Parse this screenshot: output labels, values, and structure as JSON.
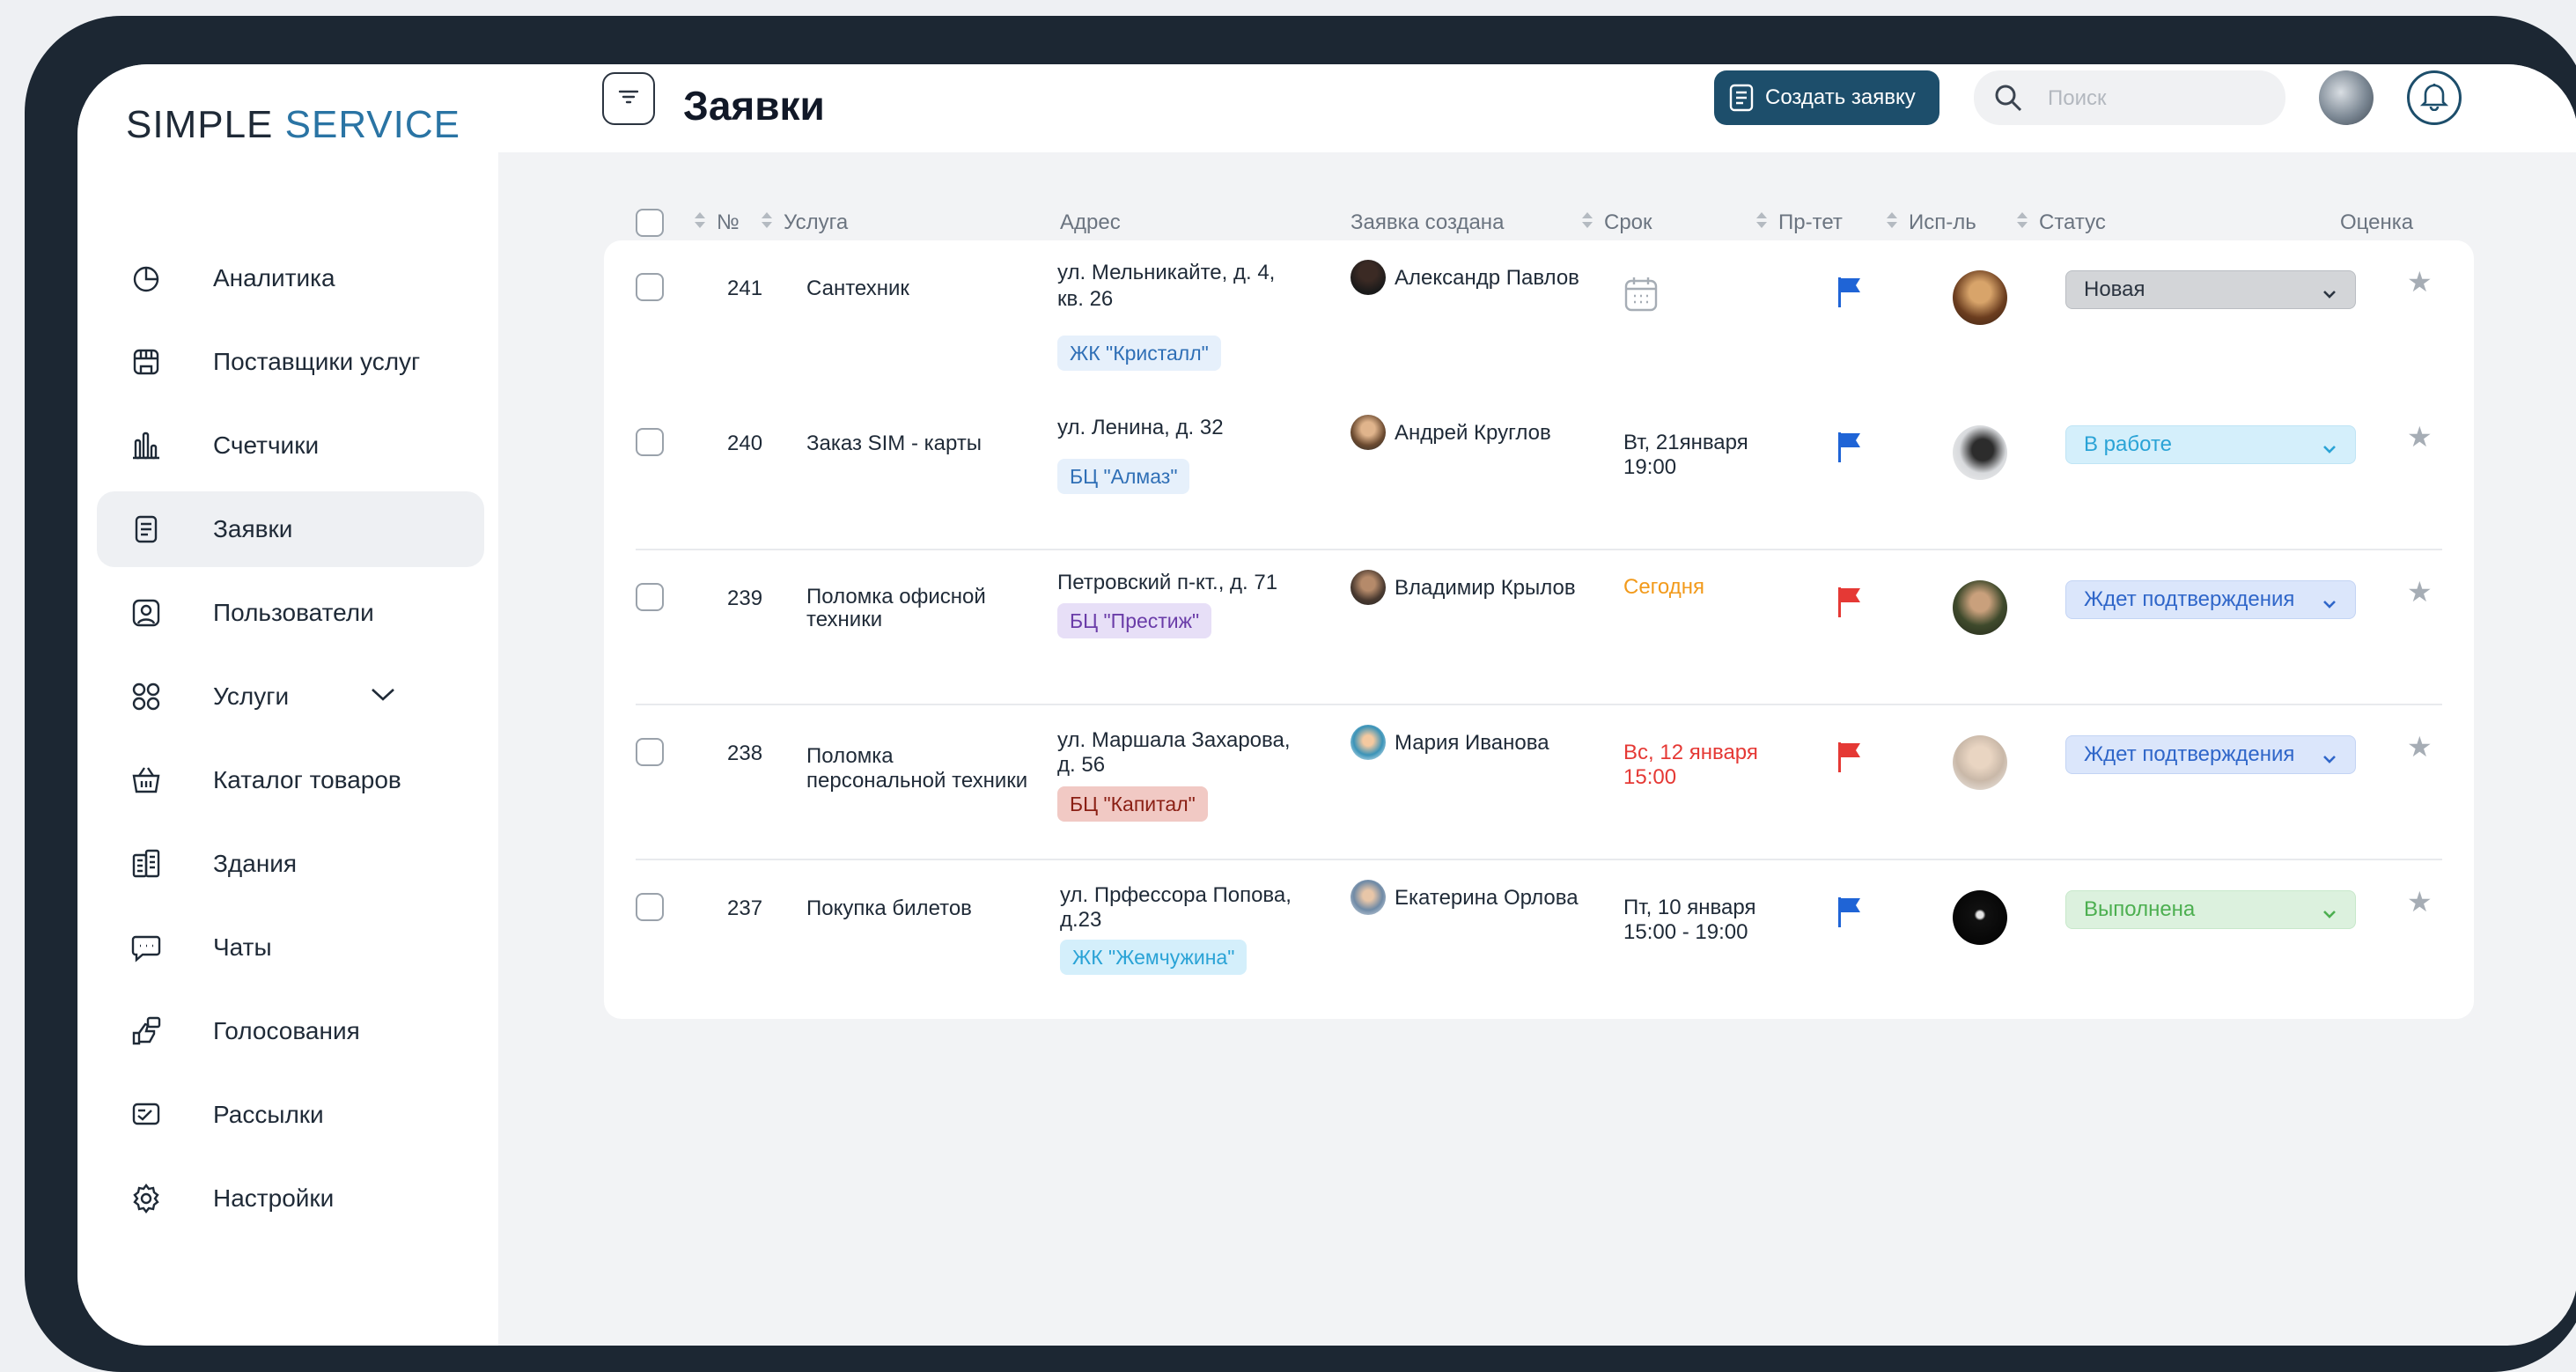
{
  "brand": {
    "part1": "SIMPLE",
    "part2": "SERVICE"
  },
  "sidebar": {
    "items": [
      {
        "label": "Аналитика",
        "icon": "pie-chart-icon"
      },
      {
        "label": "Поставщики услуг",
        "icon": "store-icon"
      },
      {
        "label": "Счетчики",
        "icon": "bar-chart-icon"
      },
      {
        "label": "Заявки",
        "icon": "document-icon",
        "active": true
      },
      {
        "label": "Пользователи",
        "icon": "user-icon"
      },
      {
        "label": "Услуги",
        "icon": "grid-icon",
        "has_chevron": true
      },
      {
        "label": "Каталог товаров",
        "icon": "basket-icon"
      },
      {
        "label": "Здания",
        "icon": "building-icon"
      },
      {
        "label": "Чаты",
        "icon": "chat-icon"
      },
      {
        "label": "Голосования",
        "icon": "vote-icon"
      },
      {
        "label": "Рассылки",
        "icon": "mail-icon"
      },
      {
        "label": "Настройки",
        "icon": "gear-icon"
      }
    ]
  },
  "header": {
    "title": "Заявки",
    "create_label": "Создать заявку",
    "search_placeholder": "Поиск"
  },
  "table": {
    "columns": {
      "num": "№",
      "service": "Услуга",
      "address": "Адрес",
      "created": "Заявка создана",
      "deadline": "Срок",
      "priority": "Пр-тет",
      "executor": "Исп-ль",
      "status": "Статус",
      "rating": "Оценка"
    },
    "rows": [
      {
        "num": "241",
        "service": [
          "Сантехник"
        ],
        "address": [
          "ул. Мельникайте, д. 4,",
          "кв. 26"
        ],
        "tag": "ЖК \"Кристалл\"",
        "creator": "Александр Павлов",
        "deadline": [],
        "status": "Новая"
      },
      {
        "num": "240",
        "service": [
          "Заказ SIM - карты"
        ],
        "address": [
          "ул. Ленина, д. 32"
        ],
        "tag": "БЦ \"Алмаз\"",
        "creator": "Андрей Круглов",
        "deadline": [
          "Вт, 21января",
          "19:00"
        ],
        "status": "В работе"
      },
      {
        "num": "239",
        "service": [
          "Поломка офисной",
          "техники"
        ],
        "address": [
          "Петровский п-кт., д. 71"
        ],
        "tag": "БЦ \"Престиж\"",
        "creator": "Владимир Крылов",
        "deadline": [
          "Сегодня"
        ],
        "status": "Ждет подтверждения"
      },
      {
        "num": "238",
        "service": [
          "Поломка",
          "персональной техники"
        ],
        "address": [
          "ул. Маршала Захарова,",
          "д. 56"
        ],
        "tag": "БЦ \"Капитал\"",
        "creator": "Мария Иванова",
        "deadline": [
          "Вс, 12 января",
          "15:00"
        ],
        "status": "Ждет подтверждения"
      },
      {
        "num": "237",
        "service": [
          "Покупка билетов"
        ],
        "address": [
          "ул. Прфессора Попова,",
          "д.23"
        ],
        "tag": "ЖК \"Жемчужина\"",
        "creator": "Екатерина Орлова",
        "deadline": [
          "Пт, 10 января",
          "15:00 - 19:00"
        ],
        "status": "Выполнена"
      }
    ]
  },
  "colors": {
    "brand_accent": "#2a74a4",
    "primary_button": "#1d4e6b",
    "priority_blue": "#1f64d6",
    "priority_red": "#e53935",
    "deadline_today": "#f29a1b",
    "deadline_overdue": "#e53935"
  }
}
